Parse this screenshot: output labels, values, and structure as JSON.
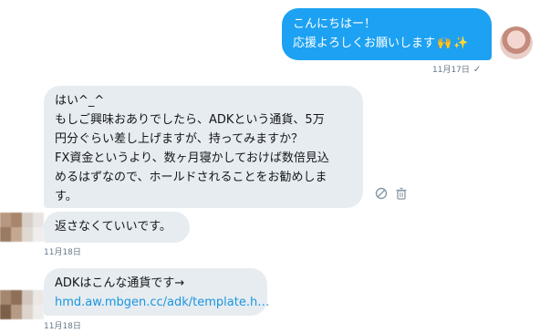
{
  "messages": [
    {
      "id": "m1",
      "direction": "outgoing",
      "lines": [
        "こんにちはー！",
        "応援よろしくお願いします"
      ],
      "emojis": [
        "raised-hands",
        "sparkles"
      ],
      "timestamp": "11月17日",
      "status": "✓"
    },
    {
      "id": "m2",
      "direction": "incoming",
      "lines": [
        "はい^_^",
        "もしご興味おありでしたら、ADKという通貨、5万",
        "円分ぐらい差し上げますが、持ってみますか？",
        "FX資金というより、数ヶ月寝かしておけば数倍見込",
        "めるはずなので、ホールドされることをお勧めしま",
        "す。"
      ]
    },
    {
      "id": "m3",
      "direction": "incoming",
      "lines": [
        "返さなくていいです。"
      ],
      "timestamp": "11月18日"
    },
    {
      "id": "m4",
      "direction": "incoming",
      "lines": [
        "ADKはこんな通貨です→"
      ],
      "link": "hmd.aw.mbgen.cc/adk/template.h…",
      "timestamp": "11月18日"
    }
  ],
  "colors": {
    "outgoing_bubble": "#1da1f2",
    "incoming_bubble": "#e6ecf0",
    "link": "#1b95e0",
    "timestamp": "#657786"
  },
  "icons": [
    "report-icon",
    "delete-icon",
    "checkmark-icon"
  ]
}
